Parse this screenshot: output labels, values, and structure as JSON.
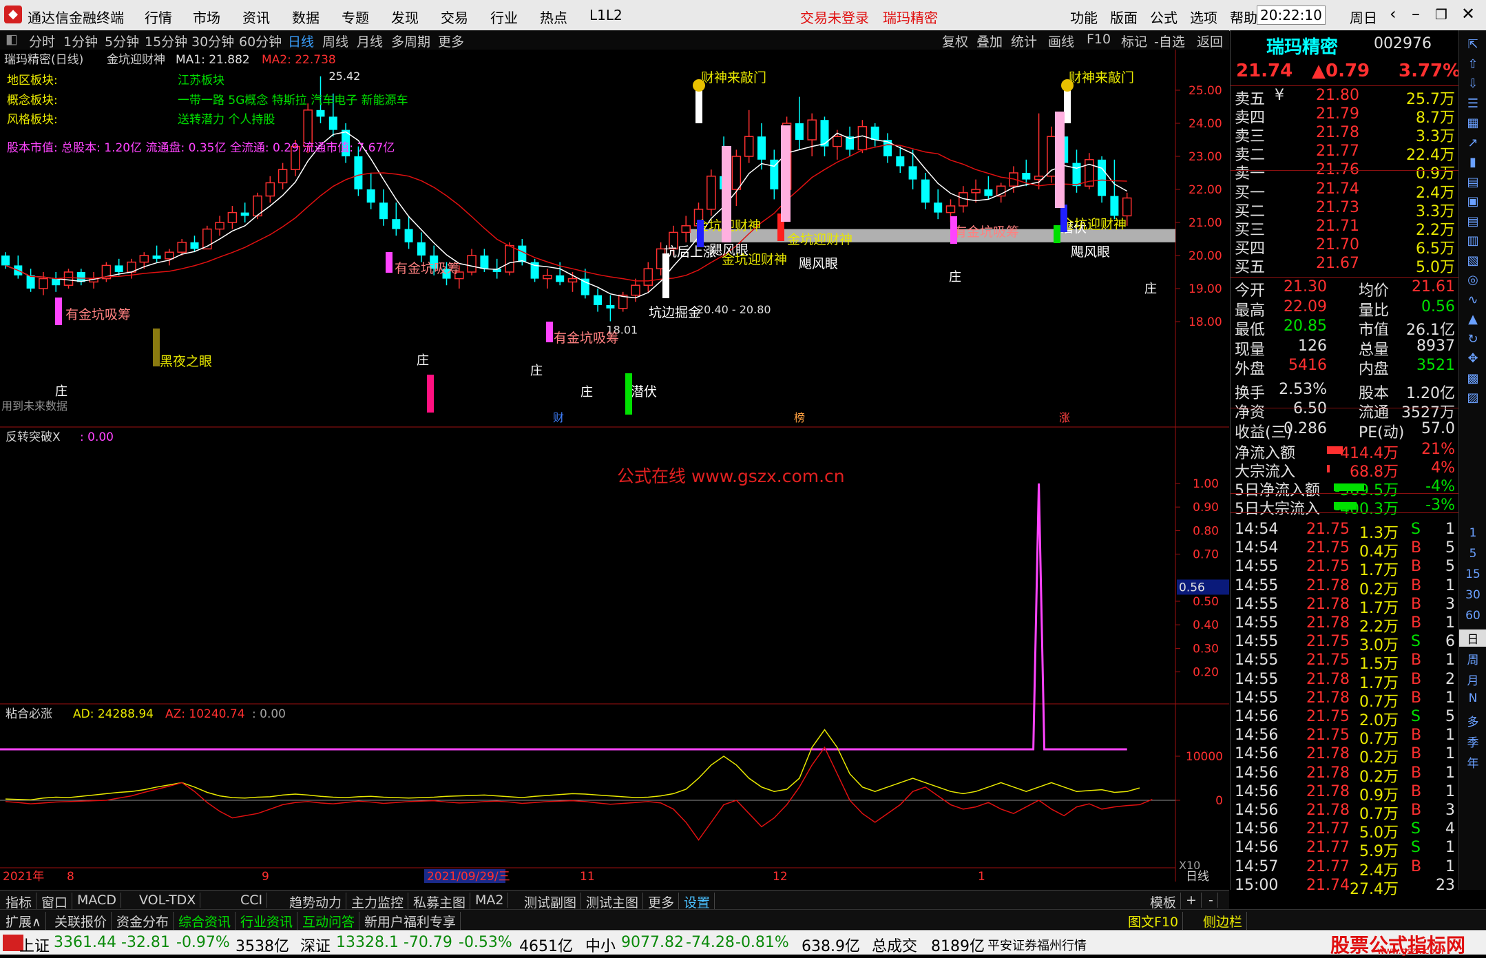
{
  "app": {
    "title": "通达信金融终端",
    "menus": [
      "行情",
      "市场",
      "资讯",
      "数据",
      "专题",
      "发现",
      "交易",
      "行业",
      "热点",
      "L1L2"
    ],
    "trade_status": "交易未登录",
    "stock_name_top": "瑞玛精密",
    "right_menus": [
      "功能",
      "版面",
      "公式",
      "选项",
      "帮助"
    ],
    "clock": "20:22:10",
    "weekday": "周日"
  },
  "periods": [
    "分时",
    "1分钟",
    "5分钟",
    "15分钟",
    "30分钟",
    "60分钟",
    "日线",
    "周线",
    "月线",
    "多周期",
    "更多"
  ],
  "active_period": "日线",
  "tools": [
    "复权",
    "叠加",
    "统计",
    "画线",
    "F10",
    "标记",
    "-自选",
    "返回"
  ],
  "main_chart": {
    "header": "瑞玛精密(日线)",
    "formula": "金坑迎财神",
    "ma1_label": "MA1: 21.882",
    "ma2_label": "MA2: 22.738",
    "region_label": "地区板块:",
    "region_value": "江苏板块",
    "concept_label": "概念板块:",
    "concept_value": "一带一路 5G概念 特斯拉 汽车电子 新能源车",
    "style_label": "风格板块:",
    "style_value": "送转潜力 个人持股",
    "capital_line": "股本市值: 总股本: 1.20亿 流通盘: 0.35亿 全流通: 0.29 流通市值: 7.67亿",
    "future_note": "用到未来数据",
    "high_label": "25.42",
    "low_label": "18.01",
    "range_label": "20.40 - 20.80",
    "y_ticks": [
      "25.00",
      "24.00",
      "23.00",
      "22.00",
      "21.00",
      "20.00",
      "19.00",
      "18.00"
    ],
    "signals": [
      {
        "text": "有金坑吸筹",
        "color": "#ff8080"
      },
      {
        "text": "黑夜之眼",
        "color": "#e8e800"
      },
      {
        "text": "有金坑吸筹",
        "color": "#ff8080"
      },
      {
        "text": "有金坑吸筹",
        "color": "#ff8080"
      },
      {
        "text": "潜伏",
        "color": "#ffffff"
      },
      {
        "text": "坑后上涨",
        "color": "#ffffff"
      },
      {
        "text": "坑边掘金",
        "color": "#ffffff"
      },
      {
        "text": "金坑迎财神",
        "color": "#e8e800"
      },
      {
        "text": "飓风眼",
        "color": "#ffffff"
      },
      {
        "text": "金坑迎财神",
        "color": "#e8e800"
      },
      {
        "text": "金坑迎财神",
        "color": "#e8e800"
      },
      {
        "text": "飓风眼",
        "color": "#ffffff"
      },
      {
        "text": "财神来敲门",
        "color": "#e8e800"
      },
      {
        "text": "有金坑吸筹",
        "color": "#ff8080"
      },
      {
        "text": "潜伏",
        "color": "#ffffff"
      },
      {
        "text": "金坑迎财神",
        "color": "#e8e800"
      },
      {
        "text": "飓风眼",
        "color": "#ffffff"
      },
      {
        "text": "财神来敲门",
        "color": "#e8e800"
      }
    ],
    "zhuang": "庄",
    "bottom_marks": [
      "财",
      "榜",
      "涨"
    ]
  },
  "panel2": {
    "title": "反转突破X",
    "value": ": 0.00",
    "watermark": "公式在线  www.gszx.com.cn",
    "y_ticks": [
      "1.00",
      "0.90",
      "0.80",
      "0.70",
      "0.56",
      "0.50",
      "0.40",
      "0.30",
      "0.20"
    ],
    "spike_value": 1.0
  },
  "panel3": {
    "title": "粘合必涨",
    "ad": "AD: 24288.94",
    "az": "AZ: 10240.74",
    "zero": ": 0.00",
    "y_ticks": [
      "10000",
      "0"
    ]
  },
  "x_axis": {
    "labels": [
      "2021年",
      "8",
      "9",
      "2021/09/29/三",
      "11",
      "12",
      "1"
    ],
    "period_tag": "日线",
    "zoom": "X10"
  },
  "quote": {
    "name": "瑞玛精密",
    "code": "002976",
    "price": "21.74",
    "change": "▲0.79",
    "pct": "3.77%",
    "asks": [
      {
        "label": "卖五",
        "mark": "¥",
        "price": "21.80",
        "vol": "25.7万"
      },
      {
        "label": "卖四",
        "mark": "",
        "price": "21.79",
        "vol": "8.7万"
      },
      {
        "label": "卖三",
        "mark": "",
        "price": "21.78",
        "vol": "3.3万"
      },
      {
        "label": "卖二",
        "mark": "",
        "price": "21.77",
        "vol": "22.4万"
      },
      {
        "label": "卖一",
        "mark": "",
        "price": "21.76",
        "vol": "0.9万"
      }
    ],
    "bids": [
      {
        "label": "买一",
        "price": "21.74",
        "vol": "2.4万"
      },
      {
        "label": "买二",
        "price": "21.73",
        "vol": "3.3万"
      },
      {
        "label": "买三",
        "price": "21.71",
        "vol": "2.2万"
      },
      {
        "label": "买四",
        "price": "21.70",
        "vol": "6.5万"
      },
      {
        "label": "买五",
        "price": "21.67",
        "vol": "5.0万"
      }
    ],
    "stats": [
      {
        "l1": "今开",
        "v1": "21.30",
        "c1": "rd",
        "l2": "均价",
        "v2": "21.61",
        "c2": "rd"
      },
      {
        "l1": "最高",
        "v1": "22.09",
        "c1": "rd",
        "l2": "量比",
        "v2": "0.56",
        "c2": "gr"
      },
      {
        "l1": "最低",
        "v1": "20.85",
        "c1": "gr",
        "l2": "市值",
        "v2": "26.1亿",
        "c2": "wh"
      },
      {
        "l1": "现量",
        "v1": "126",
        "c1": "wh",
        "l2": "总量",
        "v2": "8937",
        "c2": "wh"
      },
      {
        "l1": "外盘",
        "v1": "5416",
        "c1": "rd",
        "l2": "内盘",
        "v2": "3521",
        "c2": "gr"
      },
      {
        "l1": "换手",
        "v1": "2.53%",
        "c1": "wh",
        "l2": "股本",
        "v2": "1.20亿",
        "c2": "wh"
      },
      {
        "l1": "净资",
        "v1": "6.50",
        "c1": "wh",
        "l2": "流通",
        "v2": "3527万",
        "c2": "wh"
      },
      {
        "l1": "收益(三)",
        "v1": "0.286",
        "c1": "wh",
        "l2": "PE(动)",
        "v2": "57.0",
        "c2": "wh"
      }
    ],
    "flows": [
      {
        "label": "净流入额",
        "value": "414.4万",
        "pct": "21%",
        "color": "#ff3030",
        "bar": 0.21
      },
      {
        "label": "大宗流入",
        "value": "68.8万",
        "pct": "4%",
        "color": "#ff3030",
        "bar": 0.04
      },
      {
        "label": "5日净流入额",
        "value": "-569.5万",
        "pct": "-4%",
        "color": "#00e000",
        "bar": 0.4
      },
      {
        "label": "5日大宗流入",
        "value": "-400.3万",
        "pct": "-3%",
        "color": "#00e000",
        "bar": 0.3
      }
    ],
    "ticks": [
      {
        "t": "14:54",
        "p": "21.75",
        "v": "1.3万",
        "s": "S",
        "n": "1"
      },
      {
        "t": "14:54",
        "p": "21.75",
        "v": "0.4万",
        "s": "B",
        "n": "5"
      },
      {
        "t": "14:55",
        "p": "21.75",
        "v": "1.7万",
        "s": "B",
        "n": "5"
      },
      {
        "t": "14:55",
        "p": "21.78",
        "v": "0.2万",
        "s": "B",
        "n": "1"
      },
      {
        "t": "14:55",
        "p": "21.78",
        "v": "1.7万",
        "s": "B",
        "n": "3"
      },
      {
        "t": "14:55",
        "p": "21.78",
        "v": "2.2万",
        "s": "B",
        "n": "1"
      },
      {
        "t": "14:55",
        "p": "21.75",
        "v": "3.0万",
        "s": "S",
        "n": "6"
      },
      {
        "t": "14:55",
        "p": "21.75",
        "v": "1.5万",
        "s": "B",
        "n": "1"
      },
      {
        "t": "14:55",
        "p": "21.78",
        "v": "1.7万",
        "s": "B",
        "n": "2"
      },
      {
        "t": "14:55",
        "p": "21.78",
        "v": "0.7万",
        "s": "B",
        "n": "1"
      },
      {
        "t": "14:56",
        "p": "21.75",
        "v": "2.0万",
        "s": "S",
        "n": "5"
      },
      {
        "t": "14:56",
        "p": "21.75",
        "v": "0.7万",
        "s": "B",
        "n": "1"
      },
      {
        "t": "14:56",
        "p": "21.78",
        "v": "0.2万",
        "s": "B",
        "n": "1"
      },
      {
        "t": "14:56",
        "p": "21.78",
        "v": "0.2万",
        "s": "B",
        "n": "1"
      },
      {
        "t": "14:56",
        "p": "21.78",
        "v": "0.9万",
        "s": "B",
        "n": "1"
      },
      {
        "t": "14:56",
        "p": "21.78",
        "v": "0.7万",
        "s": "B",
        "n": "3"
      },
      {
        "t": "14:56",
        "p": "21.77",
        "v": "5.0万",
        "s": "S",
        "n": "4"
      },
      {
        "t": "14:56",
        "p": "21.77",
        "v": "5.9万",
        "s": "S",
        "n": "1"
      },
      {
        "t": "14:57",
        "p": "21.77",
        "v": "2.4万",
        "s": "B",
        "n": "1"
      },
      {
        "t": "15:00",
        "p": "21.74",
        "v": "27.4万",
        "s": "",
        "n": "23"
      }
    ]
  },
  "vtool_periods": [
    "1",
    "5",
    "15",
    "30",
    "60",
    "日",
    "周",
    "月",
    "N",
    "多",
    "季",
    "年"
  ],
  "tabs1": [
    "指标",
    "窗口",
    "MACD",
    "VOL-TDX",
    "CCI",
    "趋势动力",
    "主力监控",
    "私募主图",
    "MA2",
    "测试副图",
    "测试主图",
    "更多",
    "设置"
  ],
  "tabs1_right": [
    "模板",
    "+",
    "-"
  ],
  "tabs2": [
    "扩展∧",
    "关联报价",
    "资金分布",
    "综合资讯",
    "行业资讯",
    "互动问答",
    "新用户福利专享"
  ],
  "tabs2_right": [
    "图文F10",
    "侧边栏"
  ],
  "status": {
    "sh_name": "上证",
    "sh": "3361.44",
    "sh_chg": "-32.81",
    "sh_pct": "-0.97%",
    "sh_amt": "3538亿",
    "sz_name": "深证",
    "sz": "13328.1",
    "sz_chg": "-70.79",
    "sz_pct": "-0.53%",
    "sz_amt": "4651亿",
    "zx_name": "中小",
    "zx": "9077.82",
    "zx_chg": "-74.28",
    "zx_pct": "-0.81%",
    "zx_amt": "638.9亿",
    "total_label": "总成交",
    "total": "8189亿",
    "broker": "平安证券福州行情",
    "badge": "股票公式指标网",
    "badge_url": "www.gszx.com"
  },
  "ohlc": [
    [
      20.0,
      20.1,
      19.6,
      19.7
    ],
    [
      19.7,
      20.0,
      19.3,
      19.4
    ],
    [
      19.4,
      19.6,
      18.9,
      19.0
    ],
    [
      19.0,
      19.5,
      18.8,
      19.3
    ],
    [
      19.3,
      19.5,
      18.9,
      19.1
    ],
    [
      19.1,
      19.6,
      19.0,
      19.5
    ],
    [
      19.5,
      19.6,
      19.1,
      19.2
    ],
    [
      19.2,
      19.5,
      19.0,
      19.3
    ],
    [
      19.3,
      19.8,
      19.2,
      19.7
    ],
    [
      19.7,
      19.9,
      19.4,
      19.5
    ],
    [
      19.5,
      19.9,
      19.3,
      19.8
    ],
    [
      19.8,
      20.1,
      19.6,
      20.0
    ],
    [
      20.0,
      20.3,
      19.8,
      19.9
    ],
    [
      19.9,
      20.2,
      19.7,
      20.1
    ],
    [
      20.1,
      20.5,
      20.0,
      20.4
    ],
    [
      20.4,
      20.6,
      20.1,
      20.2
    ],
    [
      20.2,
      20.9,
      20.2,
      20.8
    ],
    [
      20.8,
      21.2,
      20.6,
      21.0
    ],
    [
      21.0,
      21.5,
      20.8,
      21.3
    ],
    [
      21.3,
      21.6,
      21.0,
      21.2
    ],
    [
      21.2,
      21.9,
      21.1,
      21.8
    ],
    [
      21.8,
      22.4,
      21.6,
      22.2
    ],
    [
      22.2,
      22.8,
      22.0,
      22.6
    ],
    [
      22.6,
      23.5,
      22.4,
      23.3
    ],
    [
      23.3,
      24.6,
      23.1,
      24.4
    ],
    [
      24.4,
      25.42,
      24.0,
      24.2
    ],
    [
      24.2,
      24.9,
      23.6,
      23.8
    ],
    [
      23.8,
      24.0,
      22.8,
      23.0
    ],
    [
      23.0,
      23.3,
      21.8,
      22.0
    ],
    [
      22.0,
      22.5,
      21.4,
      21.6
    ],
    [
      21.6,
      22.0,
      20.9,
      21.1
    ],
    [
      21.1,
      21.6,
      20.6,
      20.8
    ],
    [
      20.8,
      21.2,
      20.2,
      20.4
    ],
    [
      20.4,
      20.7,
      19.8,
      20.0
    ],
    [
      20.0,
      20.3,
      19.4,
      19.6
    ],
    [
      19.6,
      19.8,
      19.1,
      19.3
    ],
    [
      19.3,
      19.7,
      19.0,
      19.5
    ],
    [
      19.5,
      20.2,
      19.4,
      20.0
    ],
    [
      20.0,
      20.2,
      19.5,
      19.6
    ],
    [
      19.6,
      19.9,
      19.3,
      19.5
    ],
    [
      19.5,
      20.4,
      19.4,
      20.3
    ],
    [
      20.3,
      20.5,
      19.7,
      19.8
    ],
    [
      19.8,
      19.9,
      19.2,
      19.3
    ],
    [
      19.3,
      19.6,
      19.0,
      19.4
    ],
    [
      19.4,
      19.8,
      19.1,
      19.2
    ],
    [
      19.2,
      19.5,
      18.9,
      19.3
    ],
    [
      19.3,
      19.6,
      18.7,
      18.8
    ],
    [
      18.8,
      19.0,
      18.3,
      18.5
    ],
    [
      18.5,
      18.8,
      18.01,
      18.4
    ],
    [
      18.4,
      18.9,
      18.3,
      18.8
    ],
    [
      18.8,
      19.3,
      18.6,
      19.1
    ],
    [
      19.1,
      19.8,
      18.9,
      19.6
    ],
    [
      19.6,
      20.4,
      19.4,
      20.2
    ],
    [
      20.2,
      20.9,
      20.0,
      20.7
    ],
    [
      20.7,
      21.2,
      20.4,
      20.9
    ],
    [
      20.9,
      21.6,
      20.7,
      21.4
    ],
    [
      21.4,
      22.6,
      21.2,
      22.4
    ],
    [
      22.4,
      23.6,
      21.8,
      22.0
    ],
    [
      22.0,
      23.2,
      21.5,
      23.0
    ],
    [
      23.0,
      24.4,
      22.8,
      23.6
    ],
    [
      23.6,
      24.0,
      22.6,
      22.9
    ],
    [
      22.9,
      23.2,
      21.7,
      22.0
    ],
    [
      22.0,
      24.2,
      21.8,
      24.0
    ],
    [
      24.0,
      24.8,
      23.2,
      23.5
    ],
    [
      23.5,
      24.3,
      23.0,
      24.1
    ],
    [
      24.1,
      24.2,
      23.0,
      23.3
    ],
    [
      23.3,
      23.8,
      22.9,
      23.6
    ],
    [
      23.6,
      23.9,
      23.0,
      23.2
    ],
    [
      23.2,
      24.1,
      23.1,
      23.9
    ],
    [
      23.9,
      24.0,
      23.3,
      23.5
    ],
    [
      23.5,
      23.7,
      22.8,
      23.0
    ],
    [
      23.0,
      23.3,
      22.5,
      22.7
    ],
    [
      22.7,
      23.2,
      22.0,
      22.3
    ],
    [
      22.3,
      22.5,
      21.4,
      21.6
    ],
    [
      21.6,
      22.0,
      21.1,
      21.3
    ],
    [
      21.3,
      21.7,
      21.0,
      21.5
    ],
    [
      21.5,
      22.1,
      21.3,
      21.9
    ],
    [
      21.9,
      22.3,
      21.6,
      22.0
    ],
    [
      22.0,
      22.4,
      21.7,
      21.8
    ],
    [
      21.8,
      22.2,
      21.6,
      22.1
    ],
    [
      22.1,
      22.7,
      21.9,
      22.5
    ],
    [
      22.5,
      22.9,
      22.1,
      22.3
    ],
    [
      22.3,
      24.3,
      22.0,
      22.4
    ],
    [
      22.4,
      23.9,
      22.2,
      23.6
    ],
    [
      23.6,
      23.8,
      22.6,
      22.8
    ],
    [
      22.8,
      23.2,
      21.9,
      22.1
    ],
    [
      22.1,
      23.1,
      22.0,
      22.9
    ],
    [
      22.9,
      23.0,
      21.6,
      21.8
    ],
    [
      21.8,
      22.9,
      21.1,
      21.2
    ],
    [
      21.2,
      21.9,
      20.9,
      21.74
    ]
  ],
  "osc_ad": [
    300,
    200,
    100,
    500,
    700,
    600,
    900,
    1200,
    1500,
    1800,
    2000,
    2400,
    3000,
    3500,
    4000,
    3000,
    1800,
    1000,
    600,
    500,
    700,
    800,
    1200,
    1400,
    1200,
    900,
    700,
    600,
    800,
    900,
    700,
    600,
    500,
    600,
    700,
    900,
    1000,
    1100,
    1200,
    1000,
    800,
    600,
    900,
    1100,
    1300,
    1500,
    1400,
    1200,
    1000,
    800,
    600,
    700,
    1000,
    1500,
    2500,
    5000,
    8000,
    10000,
    8000,
    5000,
    3000,
    2000,
    2500,
    5000,
    12000,
    16000,
    12000,
    6000,
    3000,
    2000,
    3000,
    4000,
    5000,
    4000,
    3000,
    2000,
    1500,
    2000,
    3000,
    4000,
    3000,
    2000,
    3000,
    4000,
    3000,
    2000,
    2200,
    2400,
    1800,
    2000,
    2800
  ],
  "osc_az": [
    -300,
    -500,
    -800,
    -600,
    -400,
    -300,
    -200,
    -100,
    0,
    500,
    1000,
    1800,
    2500,
    3200,
    4000,
    2000,
    -500,
    -2500,
    -4000,
    -3500,
    -3000,
    -2000,
    -1000,
    -500,
    -300,
    -600,
    -800,
    -500,
    -200,
    -400,
    -700,
    -500,
    -300,
    -200,
    -100,
    -400,
    -600,
    -500,
    -300,
    -200,
    -400,
    -700,
    -500,
    -300,
    -200,
    -100,
    -300,
    -600,
    -900,
    -700,
    -500,
    -300,
    -600,
    -2000,
    -5000,
    -9000,
    -5000,
    -1000,
    0,
    -3000,
    -6000,
    -4000,
    -1000,
    3000,
    8000,
    12000,
    6000,
    0,
    -3000,
    -5000,
    -3000,
    -1000,
    2000,
    3000,
    1000,
    -1000,
    -2000,
    -1500,
    -500,
    -2000,
    -3000,
    -1500,
    0,
    -2000,
    -3500,
    -1500,
    -800,
    -2000,
    -1500,
    -1200,
    -1000,
    200
  ]
}
